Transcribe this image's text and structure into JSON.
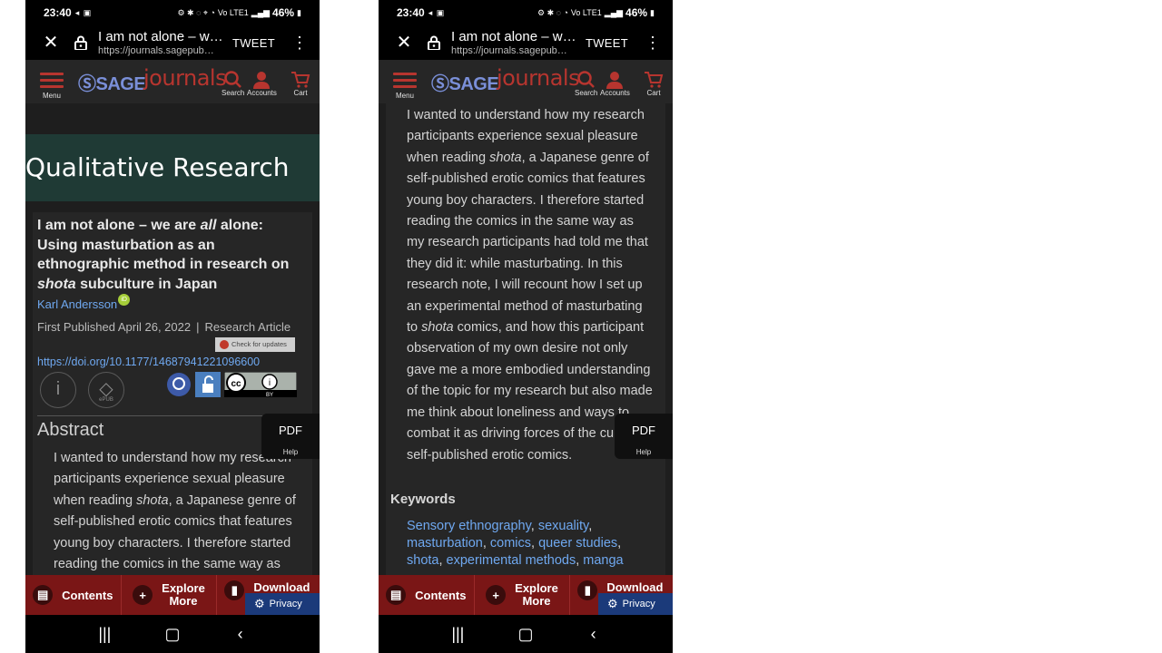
{
  "status": {
    "time": "23:40",
    "battery": "46%",
    "network": "Vo LTE1"
  },
  "tab": {
    "title": "I am not alone – w…",
    "url": "https://journals.sagepub…",
    "tweet": "TWEET"
  },
  "header": {
    "menu": "Menu",
    "sage": "SAGE",
    "journals": "journals",
    "search": "Search",
    "accounts": "Accounts",
    "cart": "Cart"
  },
  "journal": {
    "name": "Qualitative Research"
  },
  "article": {
    "title_line1_pre": "I am not alone – we are ",
    "title_line1_em": "all",
    "title_line1_post": " alone:",
    "title_line2": "Using masturbation as an",
    "title_line3": "ethnographic method in research on",
    "title_line4_em": "shota",
    "title_line4_post": " subculture in Japan",
    "author": "Karl Andersson",
    "orcid": "iD",
    "first_published": "First Published April 26, 2022",
    "type": "Research Article",
    "check_updates": "Check for updates",
    "doi": "https://doi.org/10.1177/14687941221096600",
    "epub": "ePUB",
    "cc": "BY"
  },
  "abstract": {
    "heading": "Abstract",
    "p1a": "I wanted to understand how my research participants experience sexual pleasure when reading ",
    "p1em": "shota",
    "p1b": ", a Japanese genre of self-published erotic comics that features young boy characters. I therefore started reading the comics in the same way as",
    "full_a": "I wanted to understand how my research participants experience sexual pleasure when reading ",
    "full_em1": "shota",
    "full_b": ", a Japanese genre of self-published erotic comics that features young boy characters. I therefore started reading the comics in the same way as my research participants had told me that they did it: while masturbating. In this research note, I will recount how I set up an experimental method of masturbating to ",
    "full_em2": "shota",
    "full_c": " comics, and how this participant observation of my own desire not only gave me a more embodied understanding of the topic for my research but also made me think about loneliness and ways to combat it as driving forces of the culture of self-published erotic comics."
  },
  "keywords": {
    "heading": "Keywords",
    "items": [
      "Sensory ethnography",
      "sexuality",
      "masturbation",
      "comics",
      "queer studies",
      "shota",
      "experimental methods",
      "manga"
    ]
  },
  "pdf_flyout": {
    "pdf": "PDF",
    "help": "Help"
  },
  "actions": {
    "contents": "Contents",
    "explore_1": "Explore",
    "explore_2": "More",
    "download": "Download",
    "privacy": "Privacy"
  },
  "colors": {
    "brand_red": "#b7352f",
    "link": "#6fa8f0",
    "banner": "#1f3a35",
    "action_bar": "#7a1616"
  }
}
